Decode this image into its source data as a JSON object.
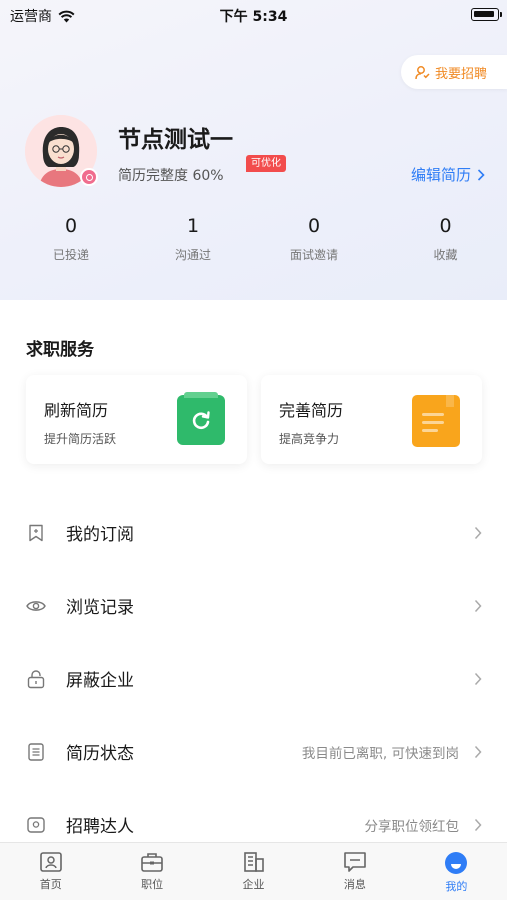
{
  "status_bar": {
    "carrier": "运营商",
    "time": "下午 5:34"
  },
  "header": {
    "recruit_label": "我要招聘",
    "user_name": "节点测试一",
    "completeness": "简历完整度 60%",
    "optimize_tag": "可优化",
    "edit_resume": "编辑简历"
  },
  "stats": [
    {
      "value": "0",
      "label": "已投递"
    },
    {
      "value": "1",
      "label": "沟通过"
    },
    {
      "value": "0",
      "label": "面试邀请"
    },
    {
      "value": "0",
      "label": "收藏"
    }
  ],
  "services": {
    "title": "求职服务",
    "cards": [
      {
        "title": "刷新简历",
        "subtitle": "提升简历活跃",
        "icon": "refresh-icon",
        "color": "#2fba6b"
      },
      {
        "title": "完善简历",
        "subtitle": "提高竞争力",
        "icon": "document-icon",
        "color": "#f9a51c"
      }
    ]
  },
  "menu": [
    {
      "label": "我的订阅",
      "hint": "",
      "icon": "bookmark-icon"
    },
    {
      "label": "浏览记录",
      "hint": "",
      "icon": "eye-icon"
    },
    {
      "label": "屏蔽企业",
      "hint": "",
      "icon": "lock-icon"
    },
    {
      "label": "简历状态",
      "hint": "我目前已离职, 可快速到岗",
      "icon": "list-icon"
    },
    {
      "label": "招聘达人",
      "hint": "分享职位领红包",
      "icon": "badge-icon"
    }
  ],
  "tabbar": [
    {
      "label": "首页",
      "icon": "home-icon"
    },
    {
      "label": "职位",
      "icon": "briefcase-icon"
    },
    {
      "label": "企业",
      "icon": "building-icon"
    },
    {
      "label": "消息",
      "icon": "message-icon"
    },
    {
      "label": "我的",
      "icon": "profile-icon",
      "active": true
    }
  ],
  "colors": {
    "accent": "#2f7df6",
    "recruit": "#f08a24",
    "tag": "#f24c4c"
  }
}
